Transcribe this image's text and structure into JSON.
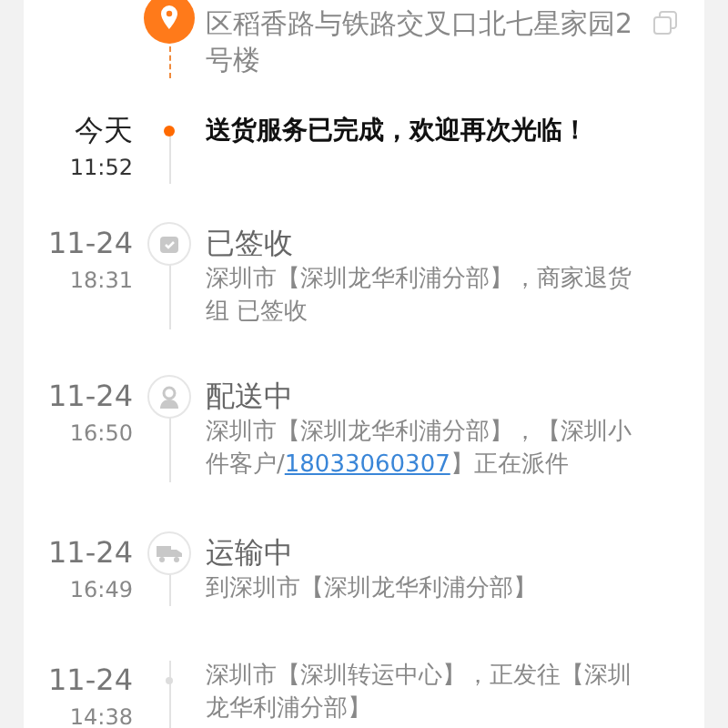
{
  "address": {
    "lines": "区稻香路与铁路交叉口北七星家园2号楼"
  },
  "events": [
    {
      "kind": "plain",
      "current": true,
      "date": "今天",
      "time": "11:52",
      "title": "送货服务已完成，欢迎再次光临！"
    },
    {
      "kind": "signed",
      "current": false,
      "date": "11-24",
      "time": "18:31",
      "title": "已签收",
      "body": "深圳市【深圳龙华利浦分部】，商家退货组 已签收"
    },
    {
      "kind": "person",
      "current": false,
      "date": "11-24",
      "time": "16:50",
      "title": "配送中",
      "body": "深圳市【深圳龙华利浦分部】，【深圳小件客户/",
      "link": "18033060307",
      "body_after": "】正在派件"
    },
    {
      "kind": "truck",
      "current": false,
      "date": "11-24",
      "time": "16:49",
      "title": "运输中",
      "body": "到深圳市【深圳龙华利浦分部】"
    },
    {
      "kind": "plain",
      "current": false,
      "date": "11-24",
      "time": "14:38",
      "body": "深圳市【深圳转运中心】，正发往【深圳龙华利浦分部】"
    }
  ]
}
